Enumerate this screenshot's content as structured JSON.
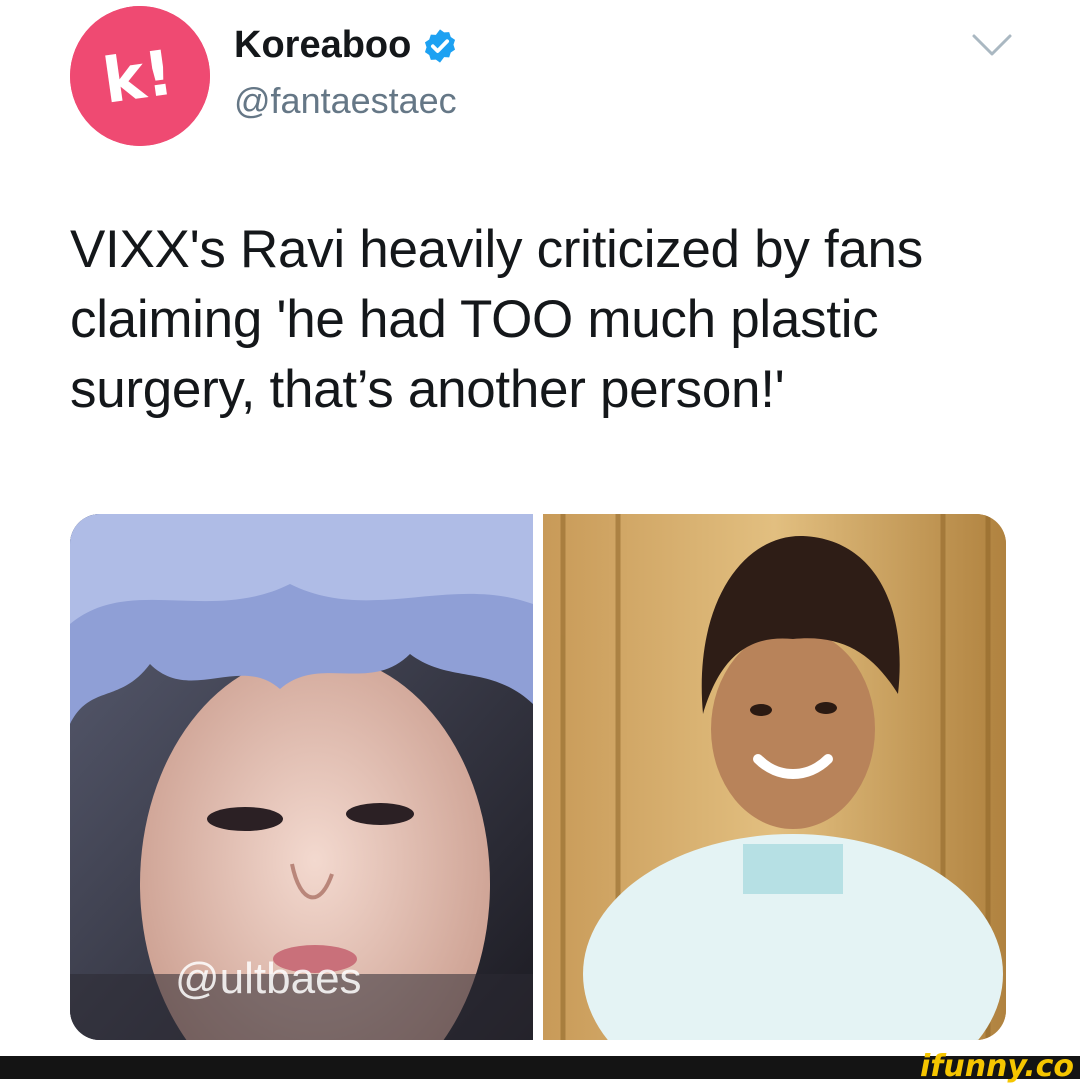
{
  "account": {
    "display_name": "Koreaboo",
    "handle": "@fantaestaec",
    "avatar_text": "k!",
    "verified": true,
    "avatar_color": "#ef4a72",
    "verified_color": "#1da1f2"
  },
  "tweet": {
    "text": "VIXX's Ravi heavily criticized by fans claiming 'he had TOO much plastic surgery, that’s another person!'"
  },
  "media": {
    "left_watermark": "@ultbaes"
  },
  "footer": {
    "watermark": "ifunny.co",
    "accent_color": "#f6c600"
  },
  "icons": {
    "verified": "verified-badge-icon",
    "menu": "chevron-down-icon"
  }
}
